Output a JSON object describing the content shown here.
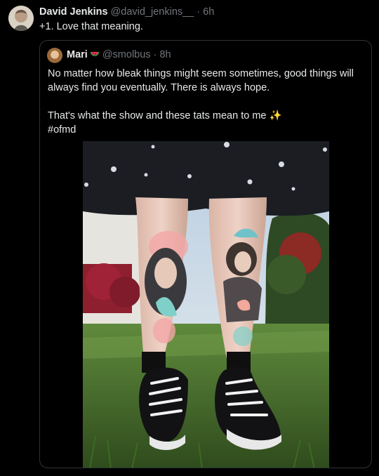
{
  "reply": {
    "author_name": "David Jenkins",
    "author_handle": "@david_jenkins__",
    "separator": "·",
    "time": "6h",
    "text": "+1. Love that meaning."
  },
  "quoted": {
    "author_name": "Mari",
    "author_badge_icon": "watermelon-icon",
    "author_handle": "@smolbus",
    "separator": "·",
    "time": "8h",
    "line1": "No matter how bleak things might seem sometimes, good things will always find you eventually. There is always hope.",
    "line2": "That's what the show and these tats mean to me",
    "line2_emoji": "✨",
    "hashtag": "#ofmd"
  },
  "colors": {
    "background": "#000000",
    "text": "#e7e9ea",
    "muted": "#71767b",
    "border": "#2f3336"
  }
}
